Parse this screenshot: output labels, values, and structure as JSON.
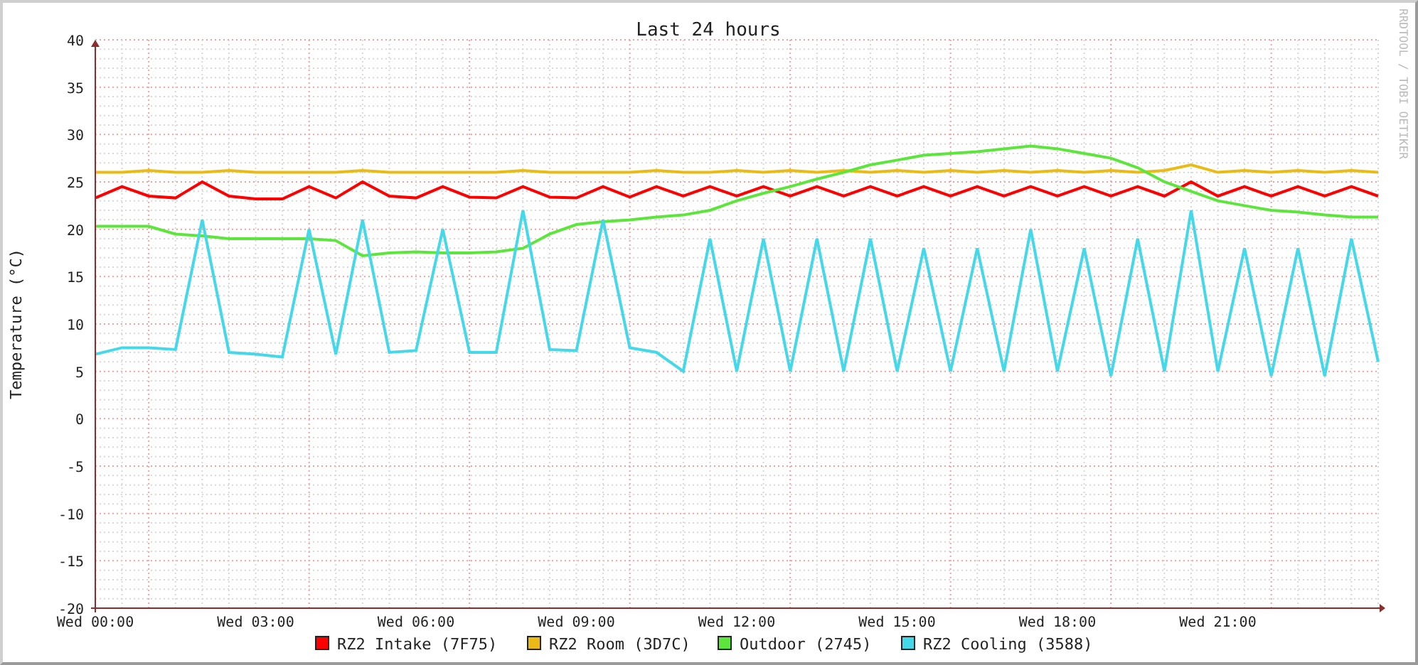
{
  "graph": {
    "credit": "RRDTOOL / TOBI OETIKER",
    "chart_data": {
      "type": "line",
      "title": "Last 24 hours",
      "ylabel": "Temperature (°C)",
      "ylim": [
        -20,
        40
      ],
      "legend": true,
      "yticks": [
        40,
        35,
        30,
        25,
        20,
        15,
        10,
        5,
        0,
        -5,
        -10,
        -15,
        -20
      ],
      "categories": [
        "Wed 00:00",
        null,
        null,
        null,
        null,
        null,
        "Wed 03:00",
        null,
        null,
        null,
        null,
        null,
        "Wed 06:00",
        null,
        null,
        null,
        null,
        null,
        "Wed 09:00",
        null,
        null,
        null,
        null,
        null,
        "Wed 12:00",
        null,
        null,
        null,
        null,
        null,
        "Wed 15:00",
        null,
        null,
        null,
        null,
        null,
        "Wed 18:00",
        null,
        null,
        null,
        null,
        null,
        "Wed 21:00",
        null,
        null,
        null,
        null,
        null,
        null
      ],
      "series": [
        {
          "name": "RZ2 Intake (7F75)",
          "color": "#ff0000",
          "values": [
            23.3,
            24.5,
            23.5,
            23.3,
            25,
            23.5,
            23.2,
            23.2,
            24.5,
            23.3,
            25,
            23.5,
            23.3,
            24.5,
            23.4,
            23.3,
            24.5,
            23.4,
            23.3,
            24.5,
            23.4,
            24.5,
            23.5,
            24.5,
            23.5,
            24.5,
            23.5,
            24.5,
            23.5,
            24.5,
            23.5,
            24.5,
            23.5,
            24.5,
            23.5,
            24.5,
            23.5,
            24.5,
            23.5,
            24.5,
            23.5,
            25,
            23.5,
            24.5,
            23.5,
            24.5,
            23.5,
            24.5,
            23.5
          ]
        },
        {
          "name": "RZ2 Room (3D7C)",
          "color": "#eabb14",
          "values": [
            26,
            26,
            26.2,
            26,
            26,
            26.2,
            26,
            26,
            26,
            26,
            26.2,
            26,
            26,
            26,
            26,
            26,
            26.2,
            26,
            26,
            26,
            26,
            26.2,
            26,
            26,
            26.2,
            26,
            26.2,
            26,
            26.2,
            26,
            26.2,
            26,
            26.2,
            26,
            26.2,
            26,
            26.2,
            26,
            26.2,
            26,
            26.2,
            26.8,
            26,
            26.2,
            26,
            26.2,
            26,
            26.2,
            26
          ]
        },
        {
          "name": "Outdoor (2745)",
          "color": "#5ce63c",
          "values": [
            20.3,
            20.3,
            20.3,
            19.5,
            19.3,
            19,
            19,
            19,
            19,
            18.8,
            17.2,
            17.5,
            17.6,
            17.5,
            17.5,
            17.6,
            18,
            19.5,
            20.5,
            20.8,
            21,
            21.3,
            21.5,
            22,
            23,
            23.8,
            24.5,
            25.3,
            26,
            26.8,
            27.3,
            27.8,
            28,
            28.2,
            28.5,
            28.8,
            28.5,
            28,
            27.5,
            26.5,
            25,
            24,
            23,
            22.5,
            22,
            21.8,
            21.5,
            21.3,
            21.3
          ]
        },
        {
          "name": "RZ2 Cooling (3588)",
          "color": "#44d8e8",
          "values": [
            6.8,
            7.5,
            7.5,
            7.3,
            21,
            7,
            6.8,
            6.5,
            20,
            6.8,
            21,
            7,
            7.2,
            20,
            7,
            7,
            22,
            7.3,
            7.2,
            21,
            7.5,
            7,
            5,
            19,
            5,
            19,
            5,
            19,
            5,
            19,
            5,
            18,
            5,
            18,
            5,
            20,
            5,
            18,
            4.5,
            19,
            5,
            22,
            5,
            18,
            4.5,
            18,
            4.5,
            19,
            6
          ]
        }
      ]
    }
  }
}
